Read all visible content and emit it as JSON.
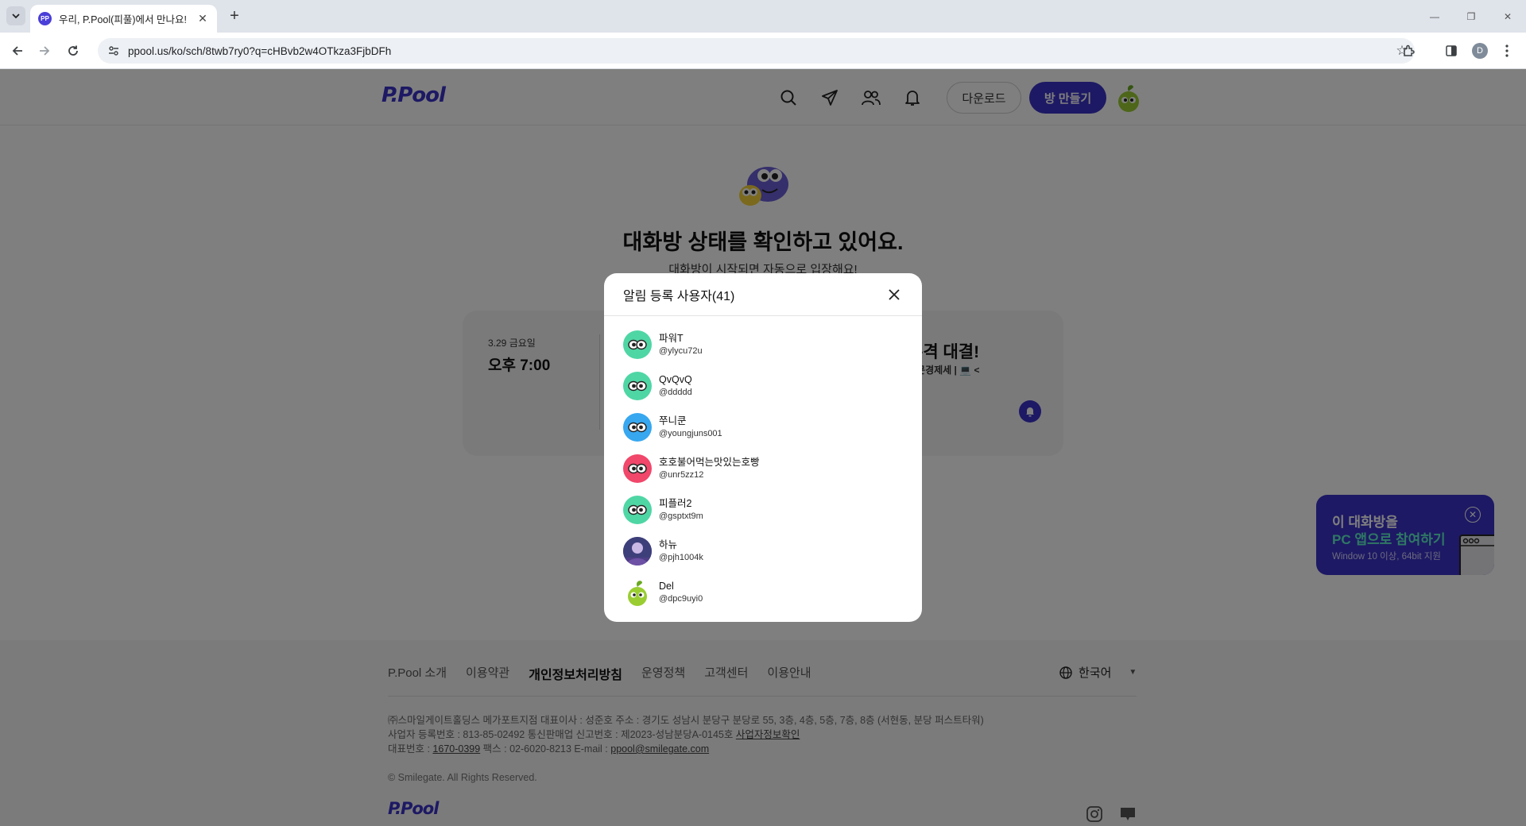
{
  "browser": {
    "tab_title": "우리, P.Pool(피풀)에서 만나요!",
    "favicon_text": "PP",
    "new_tab": "+",
    "tab_close": "✕",
    "url": "ppool.us/ko/sch/8twb7ry0?q=cHBvb2w4OTkza3FjbDFh",
    "profile_initial": "D",
    "win_minimize": "—",
    "win_restore": "❐",
    "win_close": "✕"
  },
  "header": {
    "logo": "P.Pool",
    "download_label": "다운로드",
    "create_room_label": "방 만들기"
  },
  "main": {
    "title": "대화방 상태를 확인하고 있어요.",
    "subtitle": "대화방이 시작되면 자동으로 입장해요!"
  },
  "card": {
    "date": "3.29 금요일",
    "time": "오후 7:00",
    "title": "본격 대결!",
    "meta": "통문경제세 | 💻 <"
  },
  "modal": {
    "title": "알림 등록 사용자(41)",
    "users": [
      {
        "name": "파워T",
        "handle": "@ylycu72u",
        "color": "#4fd6a5",
        "icon": "mascot-mint"
      },
      {
        "name": "QvQvQ",
        "handle": "@ddddd",
        "color": "#4fd6a5",
        "icon": "mascot-mint"
      },
      {
        "name": "쭈니쿤",
        "handle": "@youngjuns001",
        "color": "#37a7f0",
        "icon": "mascot-blue"
      },
      {
        "name": "호호불어먹는맛있는호빵",
        "handle": "@unr5zz12",
        "color": "#f0476a",
        "icon": "mascot-red"
      },
      {
        "name": "피플러2",
        "handle": "@gsptxt9m",
        "color": "#4fd6a5",
        "icon": "mascot-mint"
      },
      {
        "name": "하뉴",
        "handle": "@pjh1004k",
        "color": "#4a4a8c",
        "icon": "photo"
      },
      {
        "name": "Del",
        "handle": "@dpc9uyi0",
        "color": "#ffffff",
        "icon": "mascot-green-sprout"
      }
    ]
  },
  "promo": {
    "line1": "이 대화방을",
    "line2": "PC 앱으로 참여하기",
    "line3": "Window 10 이상, 64bit 지원"
  },
  "footer": {
    "links": [
      "P.Pool 소개",
      "이용약관",
      "개인정보처리방침",
      "운영정책",
      "고객센터",
      "이용안내"
    ],
    "language": "한국어",
    "info_line1": "㈜스마일게이트홀딩스 메가포트지점   대표이사 : 성준호   주소 : 경기도 성남시 분당구 분당로 55, 3층, 4층, 5층, 7층, 8층 (서현동, 분당 퍼스트타워)",
    "info_line2a": "사업자 등록번호 : 813-85-02492   통신판매업 신고번호 : 제2023-성남분당A-0145호   ",
    "info_line2b": "사업자정보확인",
    "info_line3a": "대표번호 : ",
    "info_phone": "1670-0399",
    "info_line3b": "   팩스 : 02-6020-8213   E-mail : ",
    "info_email": "ppool@smilegate.com",
    "copyright": "© Smilegate. All Rights Reserved.",
    "logo": "P.Pool"
  },
  "colors": {
    "brand": "#3b32c8",
    "accent_mint": "#5ef0c8"
  }
}
